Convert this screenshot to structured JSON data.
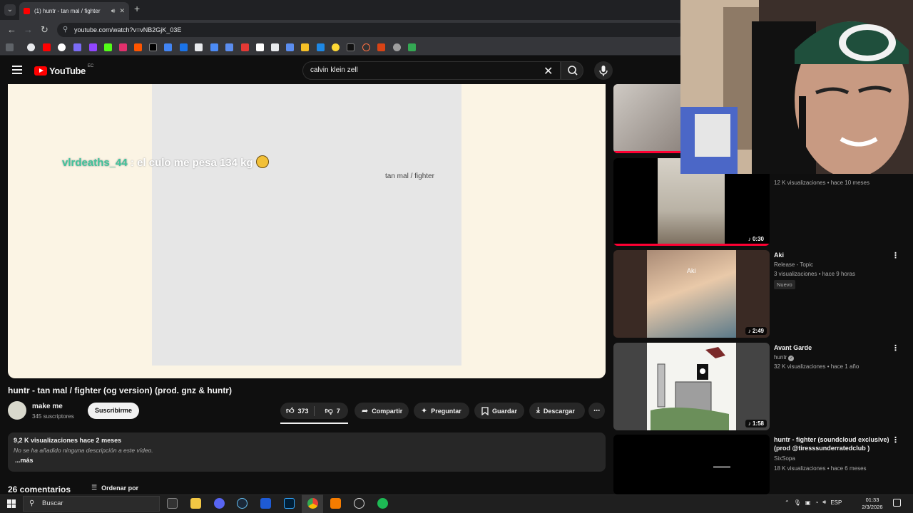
{
  "browser": {
    "tab_title": "(1) huntr - tan mal / fighter",
    "new_tab_symbol": "+",
    "url": "youtube.com/watch?v=vNB2GjK_03E"
  },
  "youtube": {
    "logo_text": "YouTube",
    "country_code": "EC",
    "search_query": "calvin klein zell"
  },
  "player": {
    "overlay_user": "vlrdeaths_44",
    "overlay_message": " : el culo me pesa 134 kg",
    "video_caption": "tan mal / fighter"
  },
  "video": {
    "title": "huntr - tan mal / fighter (og version) (prod. gnz & huntr)",
    "channel_name": "make me",
    "channel_subs": "345 suscriptores",
    "subscribe_label": "Suscribirme",
    "likes": "373",
    "dislikes": "7",
    "share_label": "Compartir",
    "ask_label": "Preguntar",
    "save_label": "Guardar",
    "download_label": "Descargar",
    "description_meta": "9,2 K visualizaciones  hace 2 meses",
    "description_text": "No se ha añadido ninguna descripción a este vídeo.",
    "description_more": "...más",
    "comments_count": "26 comentarios",
    "sort_label": "Ordenar por"
  },
  "recommendations": [
    {
      "title": "",
      "channel": "",
      "meta": "",
      "duration": "",
      "badge": ""
    },
    {
      "title": "",
      "channel": "",
      "meta": "12 K visualizaciones • hace 10 meses",
      "duration": "0:30",
      "badge": ""
    },
    {
      "title": "Aki",
      "channel": "Release - Topic",
      "meta": "3 visualizaciones • hace 9 horas",
      "duration": "2:49",
      "badge": "Nuevo",
      "thumb_text": "Aki"
    },
    {
      "title": "Avant Garde",
      "channel": "huntr",
      "meta": "32 K visualizaciones • hace 1 año",
      "duration": "1:58",
      "badge": ""
    },
    {
      "title": "huntr - fighter (soundcloud exclusive) (prod @tiresssunderratedclub )",
      "channel": "SixSopa",
      "meta": "18 K visualizaciones • hace 6 meses",
      "duration": "",
      "badge": ""
    }
  ],
  "taskbar": {
    "search_placeholder": "Buscar",
    "language": "ESP",
    "time": "01:33",
    "date": "2/3/2026"
  },
  "colors": {
    "yt_red": "#ff0000",
    "accent_green": "#40c49a",
    "progress_red": "#ff0033"
  },
  "icons": [
    "menu-icon",
    "search-icon",
    "mic-icon",
    "clear-icon",
    "like-icon",
    "dislike-icon",
    "share-icon",
    "sparkle-icon",
    "bookmark-icon",
    "download-icon",
    "more-icon",
    "sort-icon",
    "windows-icon",
    "verified-icon",
    "music-note-icon"
  ]
}
